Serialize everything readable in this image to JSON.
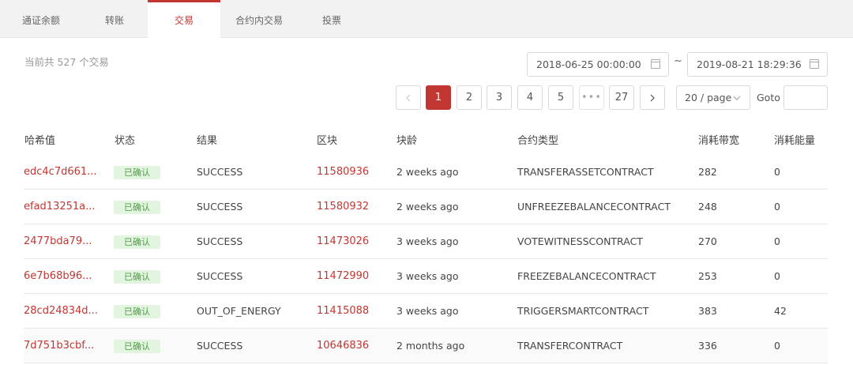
{
  "tabs": [
    {
      "label": "通证余额"
    },
    {
      "label": "转账"
    },
    {
      "label": "交易"
    },
    {
      "label": "合约内交易"
    },
    {
      "label": "投票"
    }
  ],
  "summary": "当前共 527 个交易",
  "date_range": {
    "start": "2018-06-25 00:00:00",
    "separator": "~",
    "end": "2019-08-21 18:29:36"
  },
  "pagination": {
    "pages": [
      "1",
      "2",
      "3",
      "4",
      "5",
      "•••",
      "27"
    ],
    "current": "1",
    "page_size": "20 / page",
    "goto_label": "Goto",
    "goto_value": ""
  },
  "columns": [
    "哈希值",
    "状态",
    "结果",
    "区块",
    "块龄",
    "合约类型",
    "消耗带宽",
    "消耗能量"
  ],
  "rows": [
    {
      "hash": "edc4c7d661...",
      "status": "已确认",
      "result": "SUCCESS",
      "block": "11580936",
      "age": "2 weeks ago",
      "contract": "TRANSFERASSETCONTRACT",
      "bandwidth": "282",
      "energy": "0"
    },
    {
      "hash": "efad13251a...",
      "status": "已确认",
      "result": "SUCCESS",
      "block": "11580932",
      "age": "2 weeks ago",
      "contract": "UNFREEZEBALANCECONTRACT",
      "bandwidth": "248",
      "energy": "0"
    },
    {
      "hash": "2477bda79...",
      "status": "已确认",
      "result": "SUCCESS",
      "block": "11473026",
      "age": "3 weeks ago",
      "contract": "VOTEWITNESSCONTRACT",
      "bandwidth": "270",
      "energy": "0"
    },
    {
      "hash": "6e7b68b96...",
      "status": "已确认",
      "result": "SUCCESS",
      "block": "11472990",
      "age": "3 weeks ago",
      "contract": "FREEZEBALANCECONTRACT",
      "bandwidth": "253",
      "energy": "0"
    },
    {
      "hash": "28cd24834d...",
      "status": "已确认",
      "result": "OUT_OF_ENERGY",
      "block": "11415088",
      "age": "3 weeks ago",
      "contract": "TRIGGERSMARTCONTRACT",
      "bandwidth": "383",
      "energy": "42"
    },
    {
      "hash": "7d751b3cbf...",
      "status": "已确认",
      "result": "SUCCESS",
      "block": "10646836",
      "age": "2 months ago",
      "contract": "TRANSFERCONTRACT",
      "bandwidth": "336",
      "energy": "0"
    }
  ],
  "colors": {
    "accent": "#c23631",
    "confirmed_bg": "#e3f5e1",
    "confirmed_text": "#46a33c"
  }
}
